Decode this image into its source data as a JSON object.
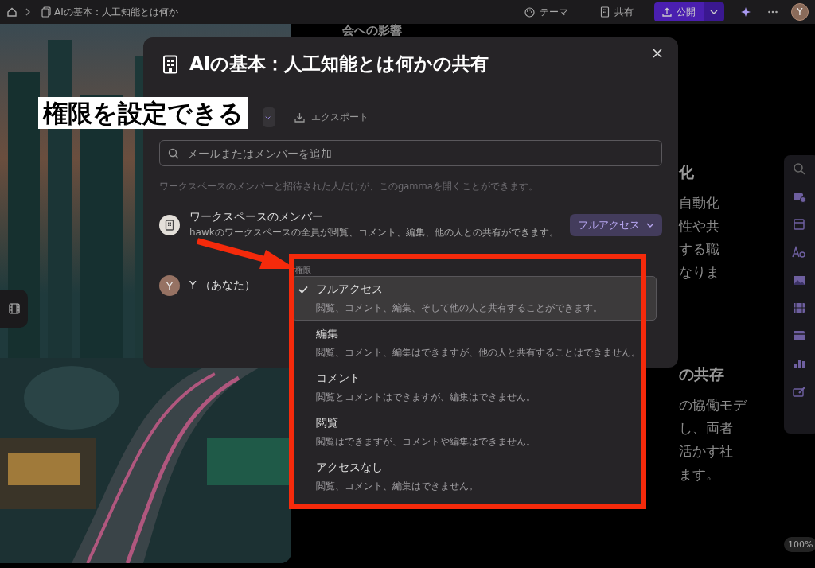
{
  "top_bar": {
    "breadcrumb": "AIの基本：人工知能とは何か",
    "theme_button": "テーマ",
    "share_button": "共有",
    "publish_button": "公開",
    "avatar": "Y"
  },
  "slide": {
    "heading_top": "会への影響",
    "sections": [
      {
        "heading": "化",
        "lines": [
          "自動化",
          "性や共",
          "する職",
          "なりま"
        ]
      },
      {
        "heading": "の共存",
        "lines": [
          "の協働モデ",
          "し、両者",
          "活かす社",
          "ます。"
        ]
      }
    ]
  },
  "zoom_badge": "100%",
  "dialog": {
    "title": "AIの基本：人工知能とは何かの共有",
    "export_button": "エクスポート",
    "search": {
      "placeholder": "メールまたはメンバーを追加"
    },
    "note": "ワークスペースのメンバーと招待された人だけが、このgammaを開くことができます。",
    "members": [
      {
        "kind": "workspace",
        "name": "ワークスペースのメンバー",
        "description": "hawkのワークスペースの全員が閲覧、コメント、編集、他の人との共有ができます。",
        "access": "フルアクセス"
      },
      {
        "kind": "person",
        "initial": "Y",
        "name": "Y （あなた）"
      }
    ]
  },
  "permission_menu": {
    "label": "権限",
    "options": [
      {
        "title": "フルアクセス",
        "description": "閲覧、コメント、編集、そして他の人と共有することができます。",
        "selected": true
      },
      {
        "title": "編集",
        "description": "閲覧、コメント、編集はできますが、他の人と共有することはできません。",
        "selected": false
      },
      {
        "title": "コメント",
        "description": "閲覧とコメントはできますが、編集はできません。",
        "selected": false
      },
      {
        "title": "閲覧",
        "description": "閲覧はできますが、コメントや編集はできません。",
        "selected": false
      },
      {
        "title": "アクセスなし",
        "description": "閲覧、コメント、編集はできません。",
        "selected": false
      }
    ]
  },
  "annotation": {
    "text": "権限を設定できる"
  }
}
